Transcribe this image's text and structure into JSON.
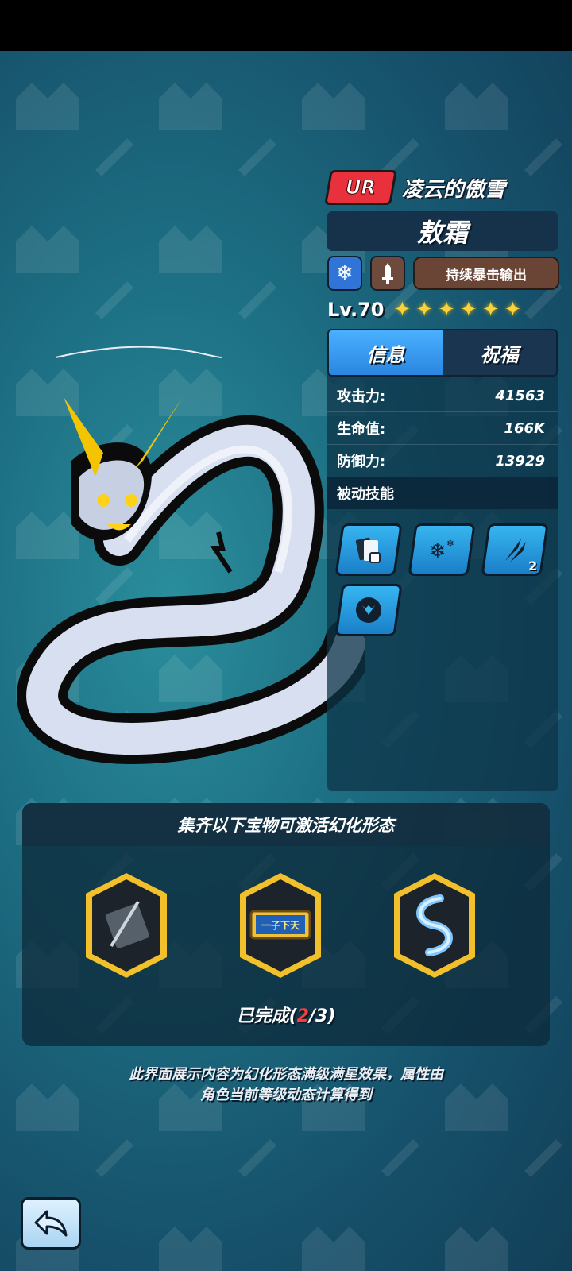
{
  "header": {
    "rarity": "UR",
    "form_title": "凌云的傲雪"
  },
  "character": {
    "name": "敖霜",
    "element_icon": "snowflake-icon",
    "weapon_icon": "sword-icon",
    "role_tag": "持续暴击输出",
    "level": "Lv.70",
    "stars": 6
  },
  "panel": {
    "tabs": [
      {
        "label": "信息",
        "active": true
      },
      {
        "label": "祝福",
        "active": false
      }
    ],
    "stats": [
      {
        "label": "攻击力:",
        "value": "41563"
      },
      {
        "label": "生命值:",
        "value": "166K"
      },
      {
        "label": "防御力:",
        "value": "13929"
      }
    ],
    "skills_title": "被动技能",
    "skills": [
      {
        "icon": "cards-dice-icon",
        "level": ""
      },
      {
        "icon": "snowflakes-icon",
        "level": ""
      },
      {
        "icon": "claw-strike-icon",
        "level": "2"
      },
      {
        "icon": "dragon-emblem-icon",
        "level": ""
      }
    ]
  },
  "collection": {
    "title": "集齐以下宝物可激活幻化形态",
    "items": [
      {
        "icon": "weapon-case-icon"
      },
      {
        "icon": "plaque-icon",
        "text": "一子下天"
      },
      {
        "icon": "ice-dragon-icon"
      }
    ],
    "progress_prefix": "已完成(",
    "progress_done": "2",
    "progress_suffix": "/3)"
  },
  "note": {
    "line1": "此界面展示内容为幻化形态满级满星效果，属性由",
    "line2": "角色当前等级动态计算得到"
  },
  "back_icon": "back-arrow-icon"
}
